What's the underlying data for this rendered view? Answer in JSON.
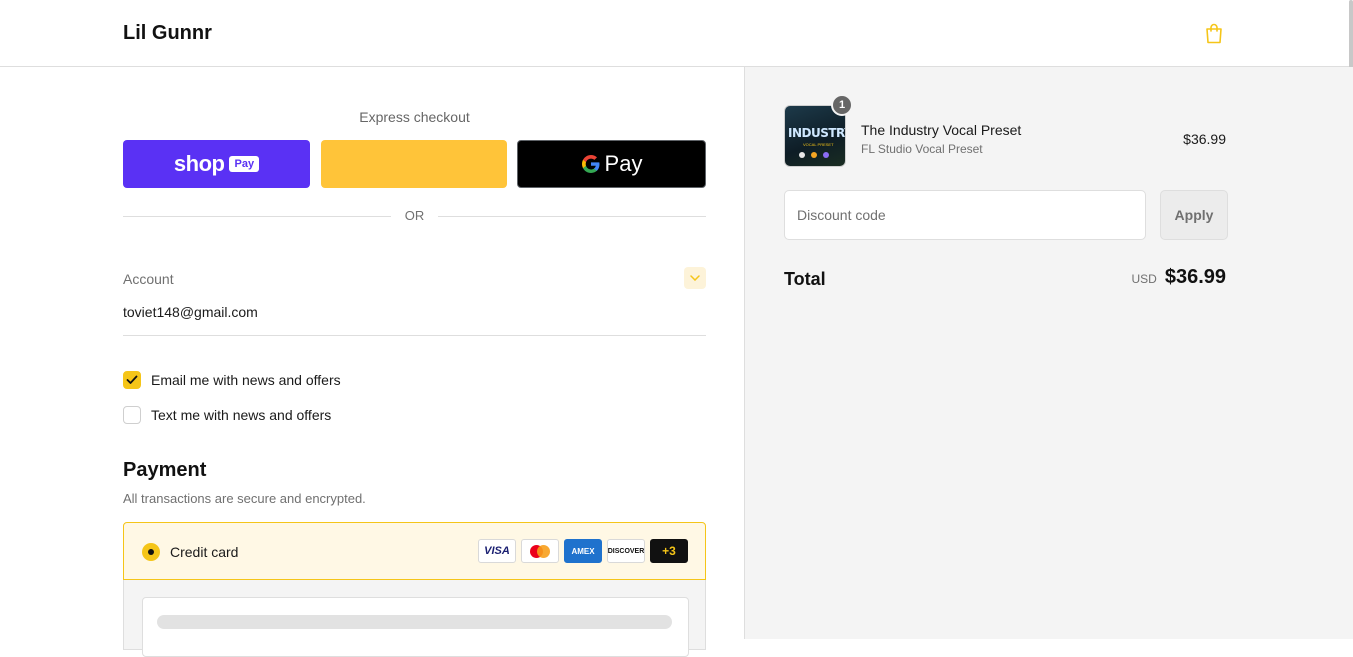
{
  "header": {
    "brand": "Lil Gunnr",
    "cart_icon": "shopping-bag-icon",
    "accent_color": "#f5c518"
  },
  "express": {
    "title": "Express checkout",
    "shop_pay": {
      "wordmark": "shop",
      "badge": "Pay",
      "color": "#5a31f4"
    },
    "paypal": {
      "color": "#ffc439"
    },
    "google_pay": {
      "label": "Pay",
      "color": "#000000"
    },
    "divider_text": "OR"
  },
  "account": {
    "label": "Account",
    "email": "toviet148@gmail.com",
    "chevron_icon": "chevron-down-icon"
  },
  "marketing": {
    "email_label": "Email me with news and offers",
    "email_checked": true,
    "text_label": "Text me with news and offers",
    "text_checked": false
  },
  "payment": {
    "title": "Payment",
    "subtitle": "All transactions are secure and encrypted.",
    "method_label": "Credit card",
    "cards": {
      "visa": "VISA",
      "amex": "AMEX",
      "discover": "DISCOVER",
      "more": "+3"
    }
  },
  "order": {
    "item": {
      "name": "The Industry Vocal Preset",
      "variant": "FL Studio Vocal Preset",
      "price": "$36.99",
      "quantity": "1",
      "thumb_title": "INDUSTRY",
      "thumb_subtitle": "VOCAL PRESET"
    },
    "discount": {
      "placeholder": "Discount code",
      "apply_label": "Apply"
    },
    "total": {
      "label": "Total",
      "currency": "USD",
      "amount": "$36.99"
    }
  }
}
